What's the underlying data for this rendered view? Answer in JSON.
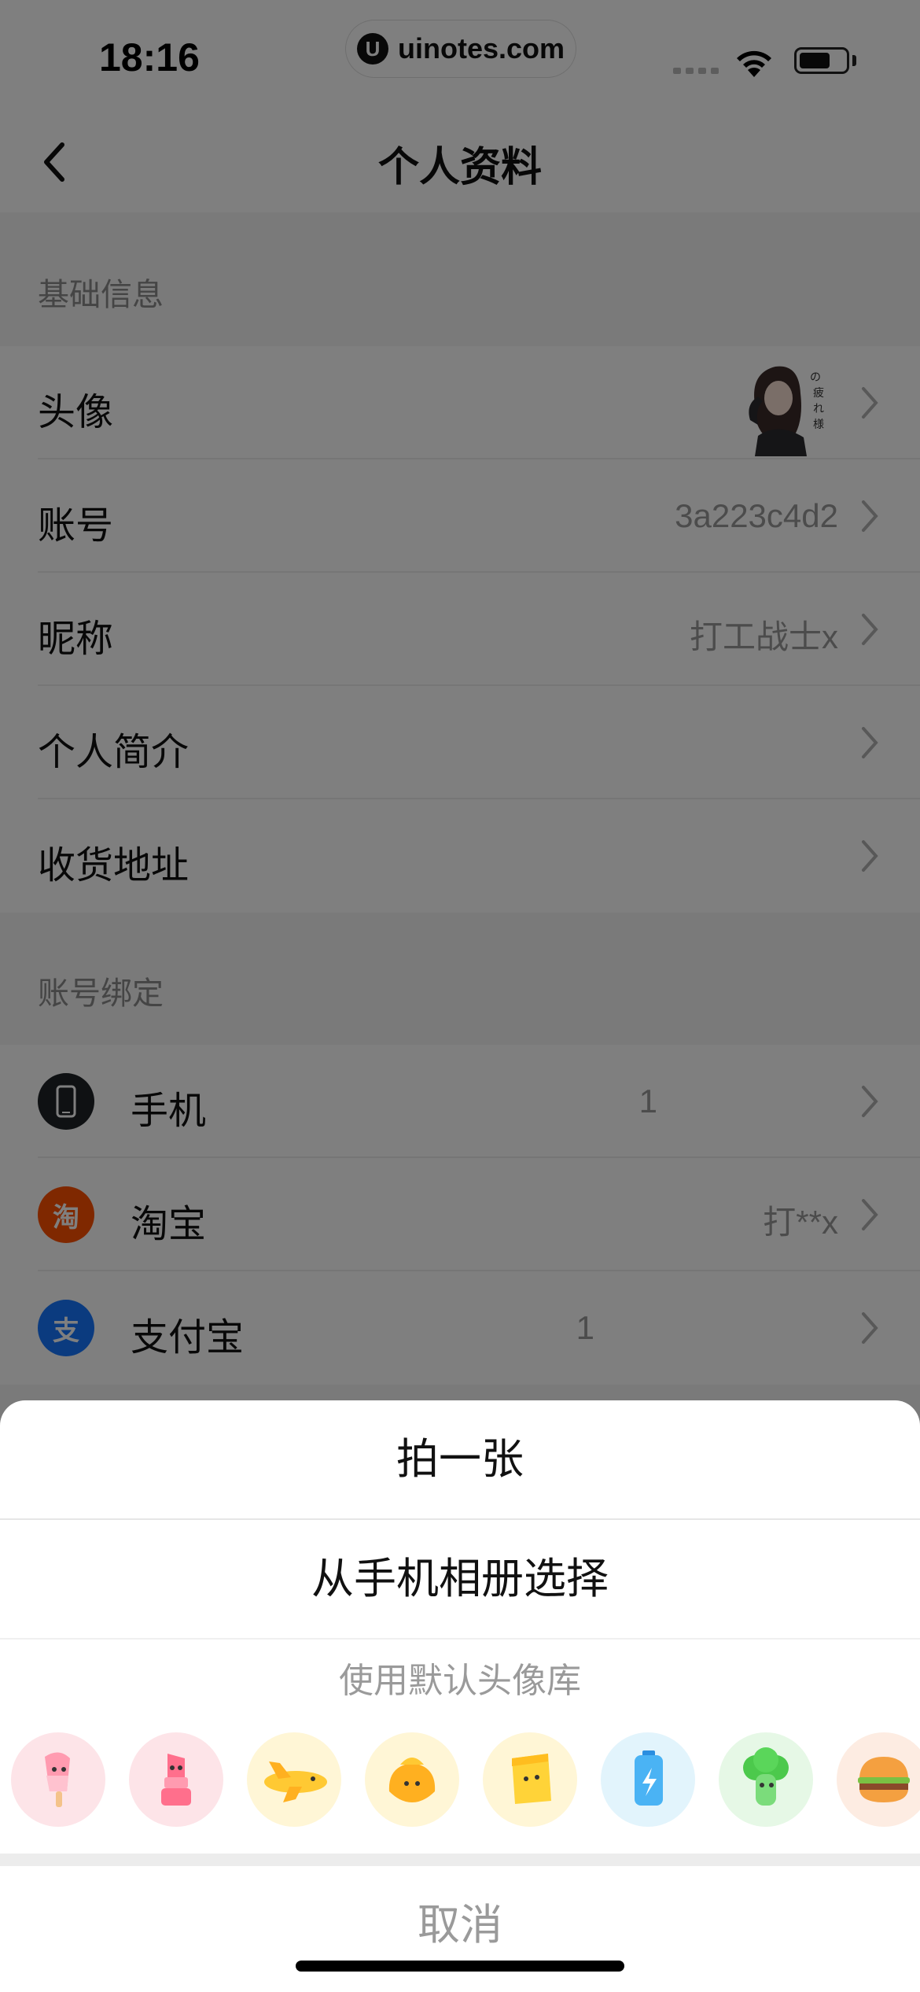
{
  "status_bar": {
    "time": "18:16",
    "watermark": "uinotes.com",
    "watermark_logo": "U"
  },
  "nav": {
    "title": "个人资料",
    "back_icon": "chevron-left-icon"
  },
  "basic_info": {
    "header": "基础信息",
    "rows": [
      {
        "label": "头像",
        "value": ""
      },
      {
        "label": "账号",
        "value": "3a223c4d2"
      },
      {
        "label": "昵称",
        "value": "打工战士x"
      },
      {
        "label": "个人简介",
        "value": ""
      },
      {
        "label": "收货地址",
        "value": ""
      }
    ]
  },
  "account_binding": {
    "header": "账号绑定",
    "rows": [
      {
        "label": "手机",
        "value": "1",
        "icon": "phone-icon",
        "color": "#1e2226"
      },
      {
        "label": "淘宝",
        "value": "打**x",
        "icon": "taobao-icon",
        "icon_text": "淘",
        "color": "#ff5000"
      },
      {
        "label": "支付宝",
        "value": "1",
        "icon": "alipay-icon",
        "icon_text": "支",
        "color": "#1677ff"
      }
    ]
  },
  "action_sheet": {
    "take_photo": "拍一张",
    "choose_album": "从手机相册选择",
    "default_library": "使用默认头像库",
    "avatars": [
      {
        "name": "popsicle",
        "bg": "#fde4e8"
      },
      {
        "name": "lipstick",
        "bg": "#fde4e8"
      },
      {
        "name": "airplane",
        "bg": "#fff6d6"
      },
      {
        "name": "bun",
        "bg": "#fff6d6"
      },
      {
        "name": "chips",
        "bg": "#fff6d6"
      },
      {
        "name": "battery",
        "bg": "#e2f4fc"
      },
      {
        "name": "broccoli",
        "bg": "#e6f8e6"
      },
      {
        "name": "burger",
        "bg": "#fdece2"
      }
    ],
    "cancel": "取消"
  }
}
